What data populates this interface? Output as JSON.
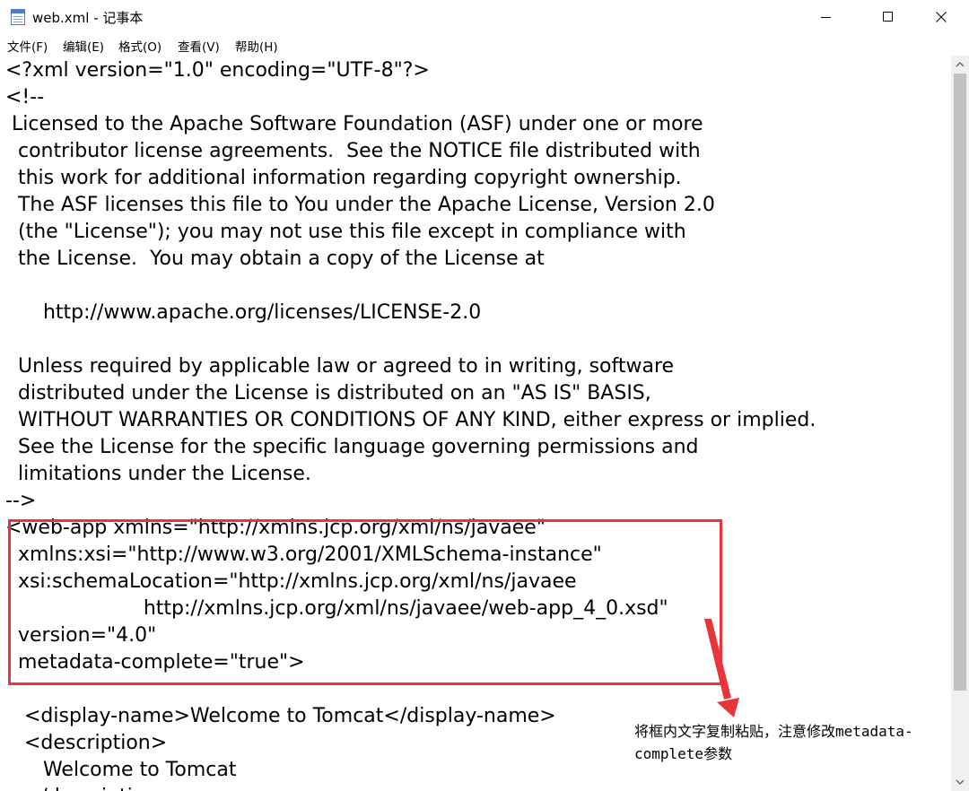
{
  "window": {
    "title": "web.xml - 记事本",
    "buttons": {
      "minimize": "minimize",
      "maximize": "maximize",
      "close": "close"
    }
  },
  "menu": [
    {
      "label": "文件(F)"
    },
    {
      "label": "编辑(E)"
    },
    {
      "label": "格式(O)"
    },
    {
      "label": "查看(V)"
    },
    {
      "label": "帮助(H)"
    }
  ],
  "editor": {
    "lines": [
      "<?xml version=\"1.0\" encoding=\"UTF-8\"?>",
      "<!--",
      " Licensed to the Apache Software Foundation (ASF) under one or more",
      "  contributor license agreements.  See the NOTICE file distributed with",
      "  this work for additional information regarding copyright ownership.",
      "  The ASF licenses this file to You under the Apache License, Version 2.0",
      "  (the \"License\"); you may not use this file except in compliance with",
      "  the License.  You may obtain a copy of the License at",
      "",
      "      http://www.apache.org/licenses/LICENSE-2.0",
      "",
      "  Unless required by applicable law or agreed to in writing, software",
      "  distributed under the License is distributed on an \"AS IS\" BASIS,",
      "  WITHOUT WARRANTIES OR CONDITIONS OF ANY KIND, either express or implied.",
      "  See the License for the specific language governing permissions and",
      "  limitations under the License.",
      "-->",
      "<web-app xmlns=\"http://xmlns.jcp.org/xml/ns/javaee\"",
      "  xmlns:xsi=\"http://www.w3.org/2001/XMLSchema-instance\"",
      "  xsi:schemaLocation=\"http://xmlns.jcp.org/xml/ns/javaee",
      "                      http://xmlns.jcp.org/xml/ns/javaee/web-app_4_0.xsd\"",
      "  version=\"4.0\"",
      "  metadata-complete=\"true\">",
      "",
      "   <display-name>Welcome to Tomcat</display-name>",
      "   <description>",
      "      Welcome to Tomcat",
      "   </description>"
    ]
  },
  "annotation": {
    "note": "将框内文字复制粘贴，注意修改metadata-complete参数",
    "color": "#e8343a"
  }
}
